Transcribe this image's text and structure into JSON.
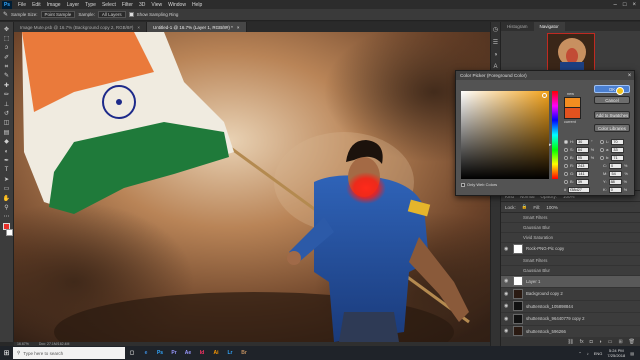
{
  "app": {
    "logo": "Ps"
  },
  "menubar": {
    "items": [
      "File",
      "Edit",
      "Image",
      "Layer",
      "Type",
      "Select",
      "Filter",
      "3D",
      "View",
      "Window",
      "Help"
    ],
    "win_controls": [
      "minimize-icon",
      "maximize-icon",
      "close-icon"
    ]
  },
  "options": {
    "sample_size_label": "Sample Size:",
    "sample_size_value": "Point Sample",
    "sample_label": "Sample:",
    "sample_value": "All Layers",
    "show_ring": "Show Sampling Ring"
  },
  "tabs": [
    {
      "label": "Image Mute.psb @ 16.7% (Background copy 2, RGB/8#)",
      "active": false
    },
    {
      "label": "Untitled-1 @ 16.7% (Layer 1, RGB/8#) *",
      "active": true
    }
  ],
  "tools": [
    "move-icon",
    "marquee-icon",
    "lasso-icon",
    "quick-select-icon",
    "crop-icon",
    "eyedropper-icon",
    "healing-icon",
    "brush-icon",
    "stamp-icon",
    "history-brush-icon",
    "eraser-icon",
    "gradient-icon",
    "blur-icon",
    "dodge-icon",
    "pen-icon",
    "type-icon",
    "path-select-icon",
    "shape-icon",
    "hand-icon",
    "zoom-icon",
    "more-icon"
  ],
  "statusbar": {
    "zoom": "16.67%",
    "doc": "Doc: 27.1M/162.4M"
  },
  "panels": {
    "tabs": [
      "Histogram",
      "Navigator"
    ]
  },
  "picker": {
    "title": "Color Picker (Foreground Color)",
    "new_label": "new",
    "current_label": "current",
    "ok": "OK",
    "cancel": "Cancel",
    "add_swatches": "Add to Swatches",
    "color_libraries": "Color Libraries",
    "only_web": "Only Web Colors",
    "fields": {
      "H": "30",
      "S": "84",
      "B": "95",
      "R": "243",
      "G": "141",
      "Bv": "39",
      "L": "70",
      "a": "33",
      "b": "71",
      "C": "0",
      "M": "54",
      "Y": "88",
      "K": "0",
      "hex": "f38d27"
    },
    "new_color": "#f38d20",
    "current_color": "#e2521f"
  },
  "layers": {
    "head": [
      "Kind",
      "Normal",
      "Opacity:",
      "100%",
      "Lock:",
      "Fill:",
      "100%"
    ],
    "rows": [
      {
        "name": "Smart Filters",
        "type": "sub"
      },
      {
        "name": "Gaussian Blur",
        "type": "sub"
      },
      {
        "name": "Vivid Saturation",
        "type": "sub"
      },
      {
        "name": "Rock-PNG-Pic copy",
        "type": "layer",
        "fx": ""
      },
      {
        "name": "Smart Filters",
        "type": "sub"
      },
      {
        "name": "Gaussian Blur",
        "type": "sub"
      },
      {
        "name": "Layer 1",
        "type": "layer",
        "fx": "",
        "selected": true
      },
      {
        "name": "Background copy 2",
        "type": "layer",
        "fx": ""
      },
      {
        "name": "shutterstock_105898844",
        "type": "layer",
        "fx": ""
      },
      {
        "name": "shutterstock_96440779 copy 2",
        "type": "layer",
        "fx": ""
      },
      {
        "name": "shutterstock_596266",
        "type": "layer",
        "fx": ""
      }
    ]
  },
  "taskbar": {
    "search_placeholder": "Type here to search",
    "apps": [
      "Ps",
      "Pr",
      "Ae",
      "Id",
      "Ai",
      "Lr",
      "Br"
    ],
    "lang": "ENG",
    "time": "5:24 PM",
    "date": "7/25/2018"
  },
  "colors": {
    "fg_swatch": "#e8302a",
    "accent": "#4a7fd1"
  }
}
